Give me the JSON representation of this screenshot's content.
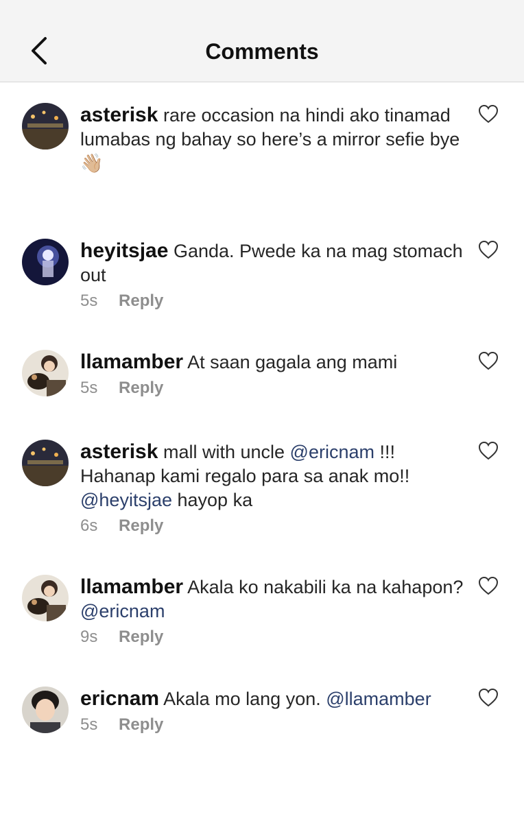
{
  "header": {
    "title": "Comments",
    "back_icon": "chevron-left-icon"
  },
  "caption": {
    "username": "asterisk",
    "text": "rare occasion na hindi ako tinamad lumabas ng bahay so here’s a mirror sefie bye",
    "emoji": "👋🏼"
  },
  "comments": [
    {
      "username": "heyitsjae",
      "text": "Ganda. Pwede ka na mag stomach out",
      "time": "5s",
      "reply_label": "Reply"
    },
    {
      "username": "llamamber",
      "text": "At saan gagala ang mami",
      "time": "5s",
      "reply_label": "Reply"
    },
    {
      "username": "asterisk",
      "text_part1": "mall with uncle",
      "mention1": "@ericnam",
      "text_part2": "!!! Hahanap kami regalo para sa anak mo!!",
      "mention2": "@heyitsjae",
      "text_part3": "hayop ka",
      "time": "6s",
      "reply_label": "Reply"
    },
    {
      "username": "llamamber",
      "text_part1": "Akala ko nakabili ka na kahapon?",
      "mention1": "@ericnam",
      "time": "9s",
      "reply_label": "Reply"
    },
    {
      "username": "ericnam",
      "text_part1": "Akala mo lang yon.",
      "mention1": "@llamamber",
      "time": "5s",
      "reply_label": "Reply"
    }
  ],
  "colors": {
    "mention": "#2b3f6b",
    "meta": "#8e8e8e",
    "header_bg": "#f4f4f4"
  },
  "icons": {
    "like": "heart-outline-icon"
  }
}
